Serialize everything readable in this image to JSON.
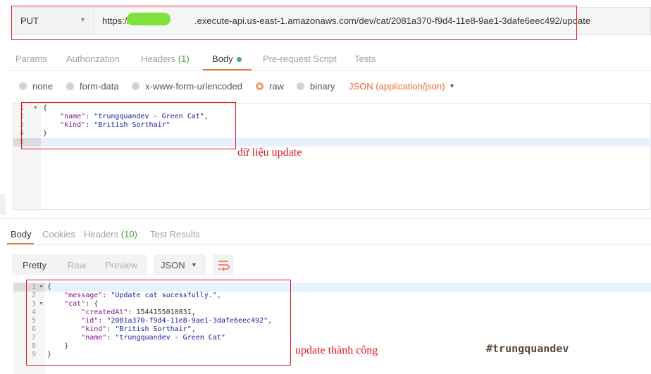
{
  "request": {
    "method": "PUT",
    "url_prefix": "https://",
    "url_rest": ".execute-api.us-east-1.amazonaws.com/dev/cat/2081a370-f9d4-11e8-9ae1-3dafe6eec492/update"
  },
  "request_tabs": [
    {
      "label": "Params"
    },
    {
      "label": "Authorization"
    },
    {
      "label": "Headers",
      "count": "(1)"
    },
    {
      "label": "Body"
    },
    {
      "label": "Pre-request Script"
    },
    {
      "label": "Tests"
    }
  ],
  "body_types": [
    "none",
    "form-data",
    "x-www-form-urlencoded",
    "raw",
    "binary"
  ],
  "content_type": "JSON (application/json)",
  "request_lines": [
    "1",
    "2",
    "3",
    "4",
    "5"
  ],
  "request_code": {
    "open": "{",
    "name_key": "\"name\"",
    "name_val": "\"trungquandev - Green Cat\"",
    "kind_key": "\"kind\"",
    "kind_val": "\"British Sorthair\"",
    "close": "}"
  },
  "annotation_request": "dữ liệu update",
  "response_tabs": [
    {
      "label": "Body"
    },
    {
      "label": "Cookies"
    },
    {
      "label": "Headers",
      "count": "(10)"
    },
    {
      "label": "Test Results"
    }
  ],
  "view_modes": [
    "Pretty",
    "Raw",
    "Preview"
  ],
  "format": "JSON",
  "response_lines": [
    "1",
    "2",
    "3",
    "4",
    "5",
    "6",
    "7",
    "8",
    "9"
  ],
  "response_code": {
    "open": "{",
    "message_key": "\"message\"",
    "message_val": "\"Update cat sucessfully.\"",
    "cat_key": "\"cat\"",
    "cat_open": "{",
    "createdAt_key": "\"createdAt\"",
    "createdAt_val": "1544155010831",
    "id_key": "\"id\"",
    "id_val": "\"2081a370-f9d4-11e8-9ae1-3dafe6eec492\"",
    "kind_key": "\"kind\"",
    "kind_val": "\"British Sorthair\"",
    "name_key": "\"name\"",
    "name_val": "\"trungquandev - Green Cat\"",
    "cat_close": "}",
    "close": "}"
  },
  "annotation_response": "update thành công",
  "watermark": "#trungquandev",
  "colors": {
    "accent": "#f26b3a",
    "annotation": "#e0161e",
    "count": "#4a9a3a"
  }
}
